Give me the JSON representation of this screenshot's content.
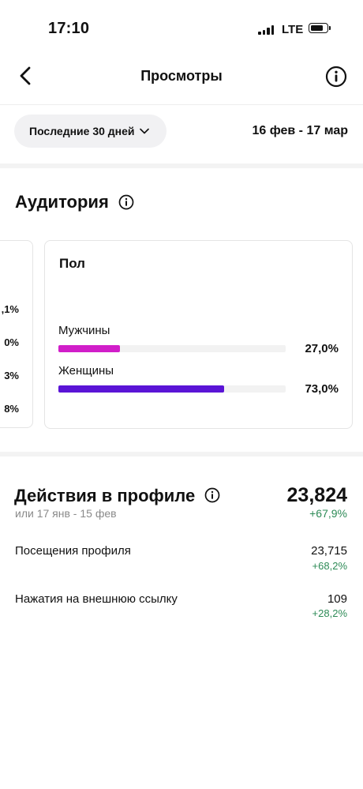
{
  "status_bar": {
    "time": "17:10",
    "network": "LTE",
    "signal_bars": 4,
    "battery_level": 0.75
  },
  "header": {
    "title": "Просмотры"
  },
  "period": {
    "selector_label": "Последние 30 дней",
    "date_range": "16 фев - 17 мар"
  },
  "audience": {
    "title": "Аудитория",
    "left_card_values": [
      ",1%",
      "0%",
      "3%",
      "8%"
    ],
    "gender_card": {
      "title": "Пол",
      "rows": [
        {
          "label": "Мужчины",
          "value": "27,0%",
          "fraction": 0.27,
          "color": "#d11ec9"
        },
        {
          "label": "Женщины",
          "value": "73,0%",
          "fraction": 0.73,
          "color": "#5a14d6"
        }
      ]
    }
  },
  "profile_actions": {
    "title": "Действия в профиле",
    "comparison_period": "или 17 янв - 15 фев",
    "total": "23,824",
    "total_change": "+67,9%",
    "metrics": [
      {
        "label": "Посещения профиля",
        "value": "23,715",
        "change": "+68,2%"
      },
      {
        "label": "Нажатия на внешнюю ссылку",
        "value": "109",
        "change": "+28,2%"
      }
    ]
  },
  "colors": {
    "positive": "#2e8b57",
    "male_bar": "#d11ec9",
    "female_bar": "#5a14d6"
  },
  "icons": [
    "back-arrow-icon",
    "info-icon",
    "chevron-down-icon",
    "signal-icon",
    "battery-icon"
  ]
}
